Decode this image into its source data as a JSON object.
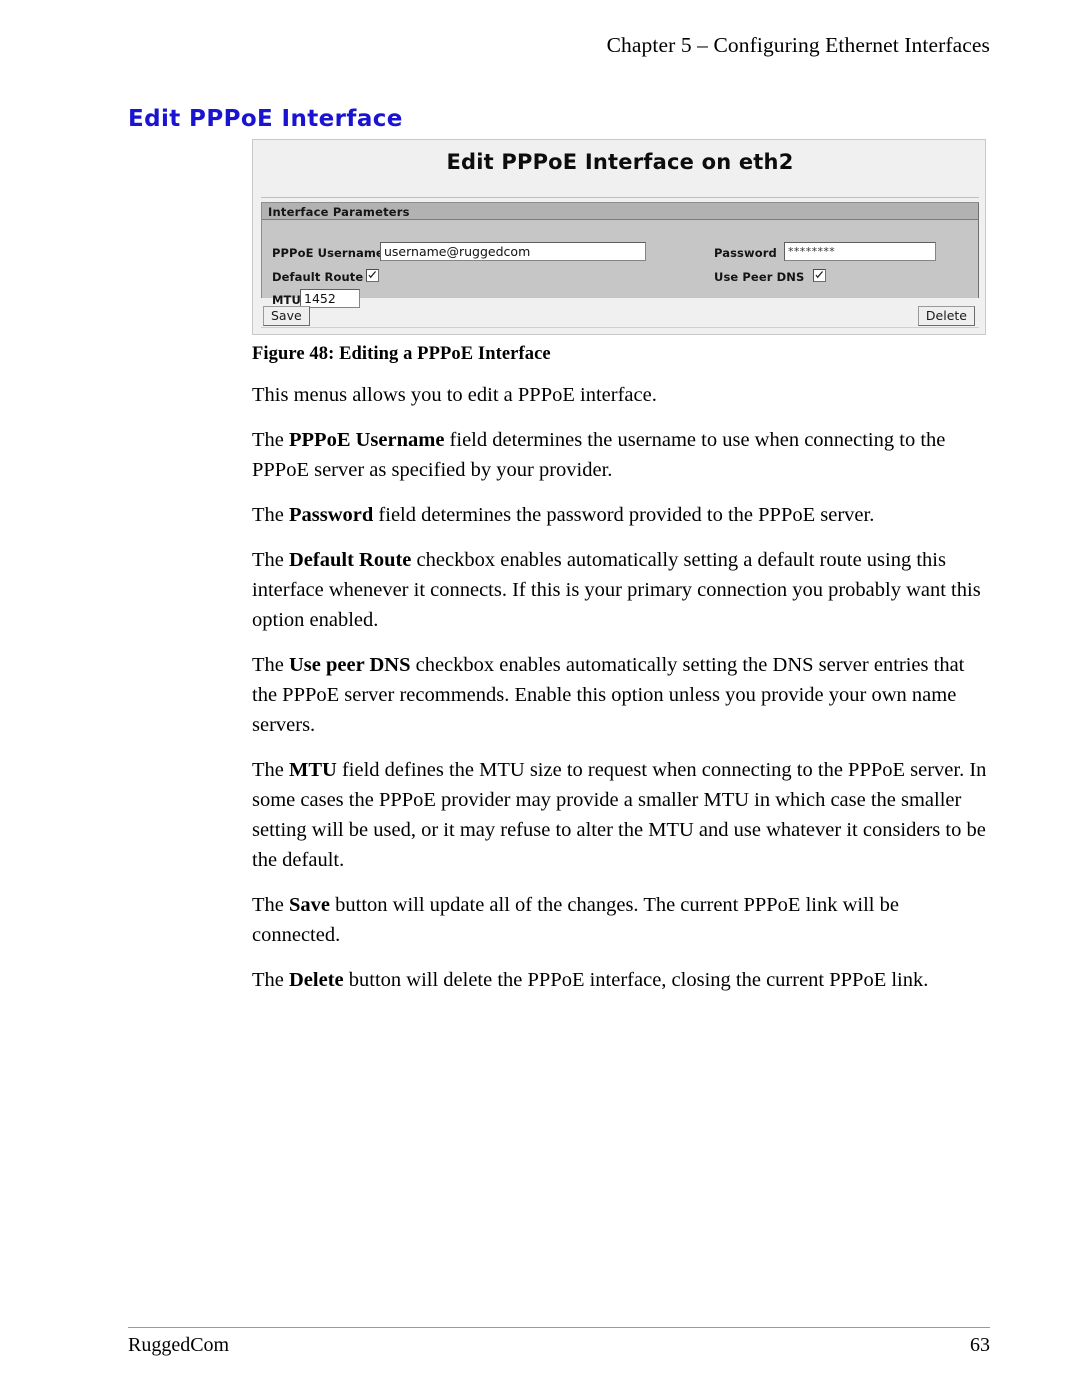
{
  "page": {
    "running_header": "Chapter 5 – Configuring Ethernet Interfaces",
    "section_heading": "Edit PPPoE Interface",
    "figure_caption": "Figure 48: Editing a PPPoE Interface",
    "heading_color": "#1a14d2"
  },
  "screenshot": {
    "title": "Edit PPPoE Interface on eth2",
    "panel_title": "Interface Parameters",
    "fields": {
      "username_label": "PPPoE Username",
      "username_value": "username@ruggedcom",
      "password_label": "Password",
      "password_value": "********",
      "default_route_label": "Default Route",
      "default_route_checked": true,
      "use_peer_dns_label": "Use Peer DNS",
      "use_peer_dns_checked": true,
      "mtu_label": "MTU",
      "mtu_value": "1452"
    },
    "buttons": {
      "save_label": "Save",
      "delete_label": "Delete"
    }
  },
  "body": {
    "p1": "This menus allows you to edit a PPPoE interface.",
    "p2_pre": "The ",
    "p2_bold": "PPPoE Username",
    "p2_post": " field determines the username to use when connecting to the PPPoE server as specified by your provider.",
    "p3_pre": "The ",
    "p3_bold": "Password",
    "p3_post": " field determines the password provided to the PPPoE server.",
    "p4_pre": "The ",
    "p4_bold": "Default Route",
    "p4_post": " checkbox enables automatically setting a default route using this interface whenever it connects.  If this is your primary connection you probably want this option enabled.",
    "p5_pre": "The ",
    "p5_bold": "Use peer DNS",
    "p5_post": " checkbox enables automatically setting the DNS server entries that the PPPoE server recommends.  Enable this option unless you provide your own name servers.",
    "p6_pre": "The ",
    "p6_bold": "MTU",
    "p6_post": " field defines the MTU size to request when connecting to the PPPoE server.  In some cases the PPPoE provider may provide a smaller MTU in which case the smaller setting will be used, or it may refuse to alter the MTU and use whatever it considers to be the default.",
    "p7_pre": "The ",
    "p7_bold": "Save",
    "p7_post": " button will update all of the changes. The current PPPoE link will be connected.",
    "p8_pre": "The ",
    "p8_bold": "Delete",
    "p8_post": " button will delete the PPPoE interface, closing the current PPPoE link."
  },
  "footer": {
    "company": "RuggedCom",
    "page_number": "63"
  }
}
